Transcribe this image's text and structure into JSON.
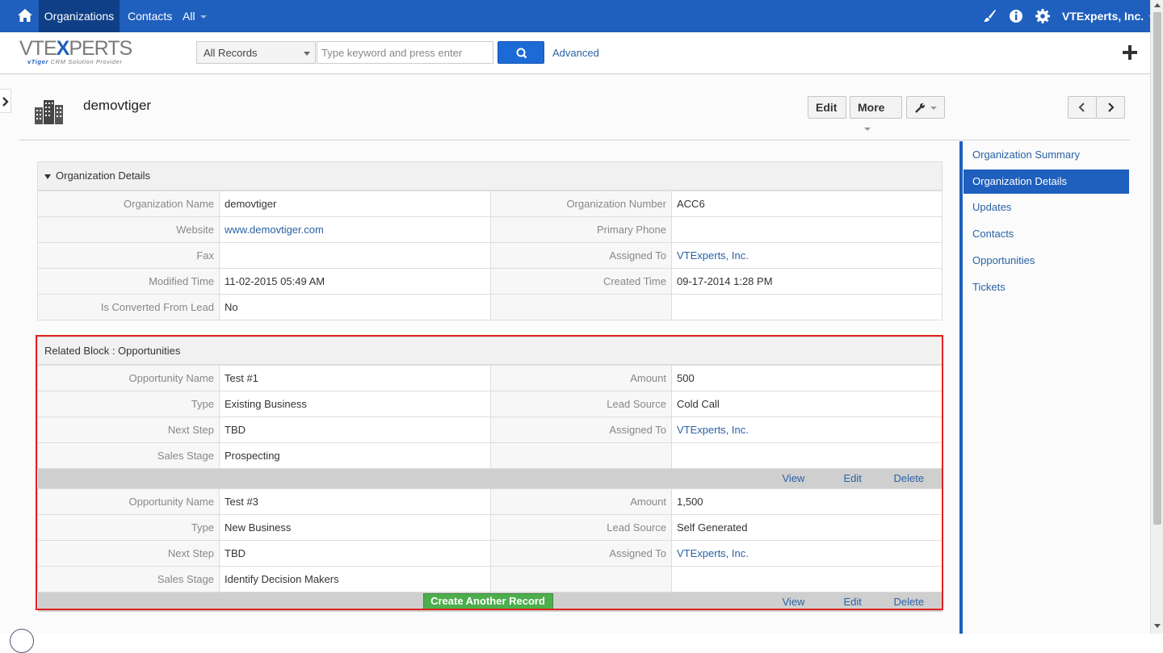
{
  "topbar": {
    "nav": [
      "Organizations",
      "Contacts",
      "All"
    ],
    "user": "VTExperts, Inc."
  },
  "header": {
    "logo_main_a": "VTE",
    "logo_main_x": "X",
    "logo_main_b": "PERTS",
    "logo_sub_a": "vTiger",
    "logo_sub_b": " CRM Solution Provider",
    "search_scope": "All Records",
    "search_placeholder": "Type keyword and press enter",
    "advanced": "Advanced"
  },
  "record": {
    "title": "demovtiger",
    "buttons": {
      "edit": "Edit",
      "more": "More"
    }
  },
  "details": {
    "header": "Organization Details",
    "rows": [
      {
        "l1": "Organization Name",
        "v1": "demovtiger",
        "l2": "Organization Number",
        "v2": "ACC6"
      },
      {
        "l1": "Website",
        "v1": "www.demovtiger.com",
        "l2": "Primary Phone",
        "v2": ""
      },
      {
        "l1": "Fax",
        "v1": "",
        "l2": "Assigned To",
        "v2": "VTExperts, Inc."
      },
      {
        "l1": "Modified Time",
        "v1": "11-02-2015 05:49 AM",
        "l2": "Created Time",
        "v2": "09-17-2014 1:28 PM"
      },
      {
        "l1": "Is Converted From Lead",
        "v1": "No",
        "l2": "",
        "v2": ""
      }
    ]
  },
  "related": {
    "header": "Related Block : Opportunities",
    "records": [
      {
        "rows": [
          {
            "l1": "Opportunity Name",
            "v1": "Test #1",
            "l2": "Amount",
            "v2": "500"
          },
          {
            "l1": "Type",
            "v1": "Existing Business",
            "l2": "Lead Source",
            "v2": "Cold Call"
          },
          {
            "l1": "Next Step",
            "v1": "TBD",
            "l2": "Assigned To",
            "v2": "VTExperts, Inc."
          },
          {
            "l1": "Sales Stage",
            "v1": "Prospecting",
            "l2": "",
            "v2": ""
          }
        ]
      },
      {
        "rows": [
          {
            "l1": "Opportunity Name",
            "v1": "Test #3",
            "l2": "Amount",
            "v2": "1,500"
          },
          {
            "l1": "Type",
            "v1": "New Business",
            "l2": "Lead Source",
            "v2": "Self Generated"
          },
          {
            "l1": "Next Step",
            "v1": "TBD",
            "l2": "Assigned To",
            "v2": "VTExperts, Inc."
          },
          {
            "l1": "Sales Stage",
            "v1": "Identify Decision Makers",
            "l2": "",
            "v2": ""
          }
        ]
      }
    ],
    "actions": {
      "view": "View",
      "edit": "Edit",
      "delete": "Delete"
    },
    "create_another": "Create Another Record"
  },
  "right_panel": {
    "links": [
      "Organization Summary",
      "Organization Details",
      "Updates",
      "Contacts",
      "Opportunities",
      "Tickets"
    ],
    "active": "Organization Details"
  },
  "colors": {
    "brand": "#1f5fbd",
    "brand_dark": "#0f3f87",
    "highlight_frame": "#e02020",
    "create_button": "#4cae4c"
  }
}
